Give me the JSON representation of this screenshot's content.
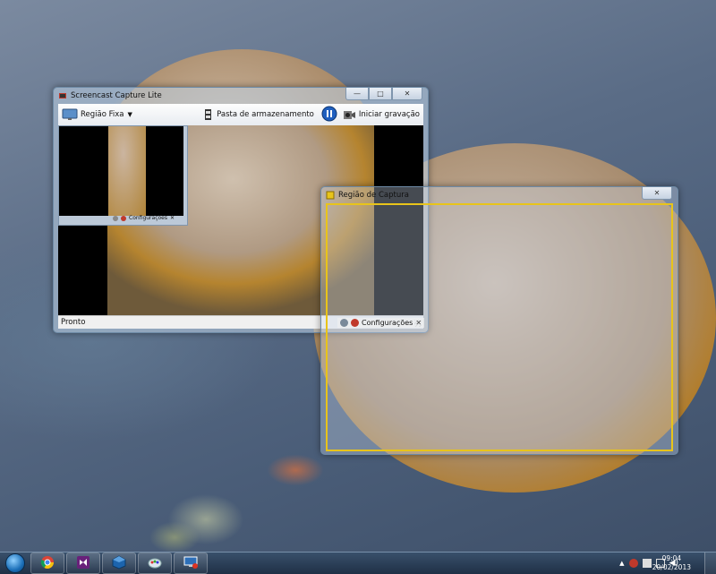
{
  "main_window": {
    "title": "Screencast Capture Lite",
    "toolbar": {
      "region_label": "Região Fixa",
      "folder_label": "Pasta de armazenamento",
      "record_label": "Iniciar gravação"
    },
    "status": "Pronto",
    "preview_footer": "Configurações"
  },
  "capture_window": {
    "title": "Região de Captura",
    "footer_label": "Configurações",
    "frame_color": "#e8c41a"
  },
  "taskbar": {
    "apps": [
      "chrome-icon",
      "visual-studio-icon",
      "virtualbox-icon",
      "paint-icon",
      "remote-desktop-icon"
    ],
    "clock_time": "09:04",
    "clock_date": "20/02/2013"
  },
  "icons": {
    "title_app": "screencast-icon",
    "minimize": "—",
    "maximize": "□",
    "close": "✕"
  }
}
